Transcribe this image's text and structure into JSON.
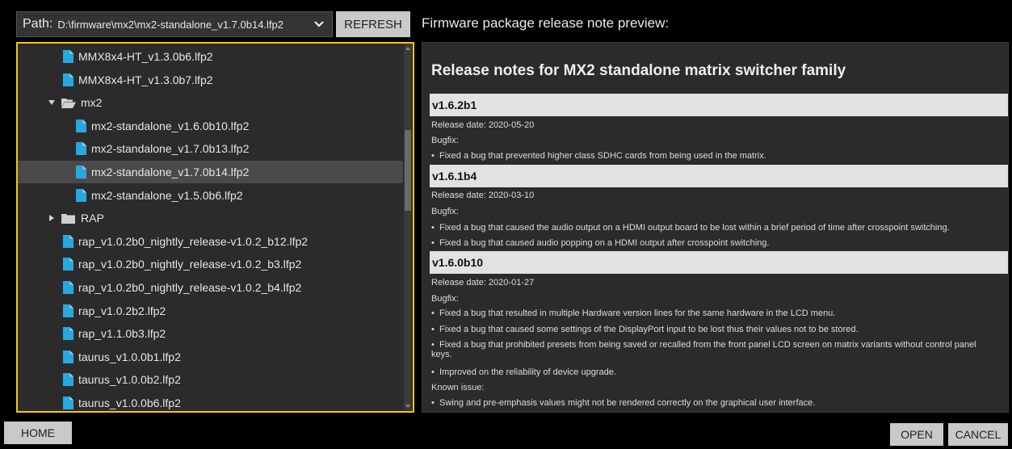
{
  "header": {
    "path_label": "Path:",
    "path_value": "D:\\firmware\\mx2\\mx2-standalone_v1.7.0b14.lfp2",
    "refresh_label": "REFRESH",
    "preview_title": "Firmware package release note preview:"
  },
  "tree": {
    "rows": [
      {
        "label": "MMX8x4-HT_v1.3.0b6.lfp2",
        "type": "file",
        "icon": "file-icon"
      },
      {
        "label": "MMX8x4-HT_v1.3.0b7.lfp2",
        "type": "file",
        "icon": "file-icon"
      },
      {
        "label": "mx2",
        "type": "folder-open",
        "icon": "folder-open-icon"
      },
      {
        "label": "mx2-standalone_v1.6.0b10.lfp2",
        "type": "file",
        "icon": "file-icon"
      },
      {
        "label": "mx2-standalone_v1.7.0b13.lfp2",
        "type": "file",
        "icon": "file-icon"
      },
      {
        "label": "mx2-standalone_v1.7.0b14.lfp2",
        "type": "file",
        "icon": "file-icon",
        "selected": true
      },
      {
        "label": "mx2-standalone_v1.5.0b6.lfp2",
        "type": "file",
        "icon": "file-icon"
      },
      {
        "label": "RAP",
        "type": "folder-closed",
        "icon": "folder-icon"
      },
      {
        "label": "rap_v1.0.2b0_nightly_release-v1.0.2_b12.lfp2",
        "type": "file",
        "icon": "file-icon"
      },
      {
        "label": "rap_v1.0.2b0_nightly_release-v1.0.2_b3.lfp2",
        "type": "file",
        "icon": "file-icon"
      },
      {
        "label": "rap_v1.0.2b0_nightly_release-v1.0.2_b4.lfp2",
        "type": "file",
        "icon": "file-icon"
      },
      {
        "label": "rap_v1.0.2b2.lfp2",
        "type": "file",
        "icon": "file-icon"
      },
      {
        "label": "rap_v1.1.0b3.lfp2",
        "type": "file",
        "icon": "file-icon"
      },
      {
        "label": "taurus_v1.0.0b1.lfp2",
        "type": "file",
        "icon": "file-icon"
      },
      {
        "label": "taurus_v1.0.0b2.lfp2",
        "type": "file",
        "icon": "file-icon"
      },
      {
        "label": "taurus_v1.0.0b6.lfp2",
        "type": "file",
        "icon": "file-icon"
      }
    ]
  },
  "notes": {
    "heading": "Release notes for MX2 standalone matrix switcher family",
    "versions": [
      {
        "version": "v1.6.2b1",
        "release_date": "Release date: 2020-05-20",
        "section": "Bugfix:",
        "items": [
          "Fixed a bug that prevented higher class SDHC cards from being used in the matrix."
        ]
      },
      {
        "version": "v1.6.1b4",
        "release_date": "Release date: 2020-03-10",
        "section": "Bugfix:",
        "items": [
          "Fixed a bug that caused the audio output on a HDMI output board to be lost within a brief period of time after crosspoint switching.",
          "Fixed a bug that caused audio popping on a HDMI output after crosspoint switching."
        ]
      },
      {
        "version": "v1.6.0b10",
        "release_date": "Release date: 2020-01-27",
        "section": "Bugfix:",
        "items": [
          "Fixed a bug that resulted in multiple Hardware version lines for the same hardware in the LCD menu.",
          "Fixed a bug that caused some settings of the DisplayPort input to be lost thus their values not to be stored.",
          "Fixed a bug that prohibited presets from being saved or recalled from the front panel LCD screen on matrix variants without control panel keys.",
          "Improved on the reliability of device upgrade."
        ],
        "known_issue_label": "Known issue:",
        "known_issues": [
          "Swing and pre-emphasis values might not be rendered correctly on the graphical user interface."
        ]
      }
    ]
  },
  "footer": {
    "home_label": "HOME",
    "open_label": "OPEN",
    "cancel_label": "CANCEL"
  },
  "colors": {
    "accent_border": "#f5c518",
    "file_icon": "#29a8e0",
    "folder_icon": "#d0d0d0",
    "button_bg": "#c9c9c9"
  }
}
